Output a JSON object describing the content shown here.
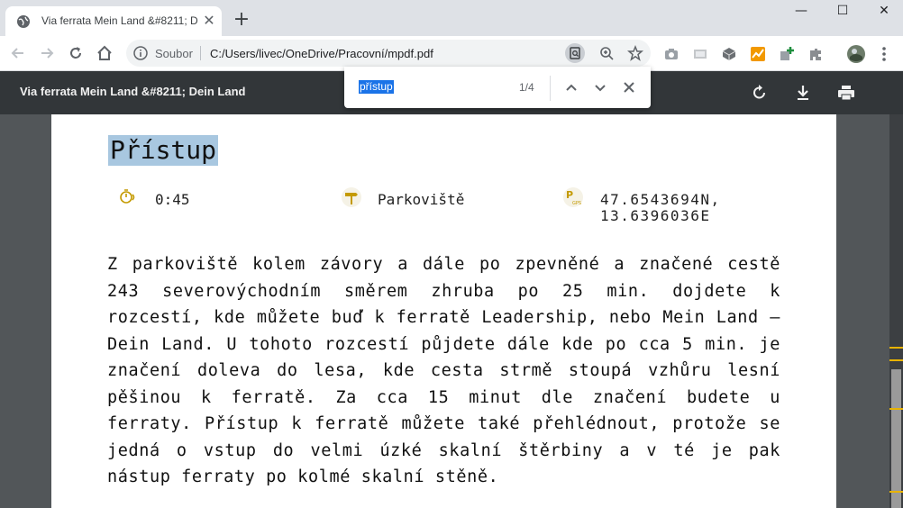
{
  "tab": {
    "title": "Via ferrata Mein Land &#8211; D",
    "close": "✕"
  },
  "newtab": "+",
  "window": {
    "minimize": "—",
    "maximize": "☐",
    "close": "✕"
  },
  "omnibox": {
    "scheme": "Soubor",
    "url": "C:/Users/livec/OneDrive/Pracovní/mpdf.pdf"
  },
  "pdf": {
    "title": "Via ferrata Mein Land &#8211; Dein Land"
  },
  "find": {
    "query": "přístup",
    "count": "1/4"
  },
  "content": {
    "heading": "Přístup",
    "time": "0:45",
    "parking": "Parkoviště",
    "gps_line1": "47.6543694N,",
    "gps_line2": "13.6396036E",
    "paragraph": "Z parkoviště kolem závory a dále po zpevněné a značené cestě 243 severovýchodním směrem zhruba po 25 min. dojdete k rozcestí, kde můžete buď k ferratě Leadership, nebo Mein Land – Dein Land. U tohoto rozcestí půjdete dále kde po cca 5 min. je značení doleva do lesa, kde cesta strmě stoupá vzhůru lesní pěšinou k ferratě. Za cca 15 minut dle značení budete u ferraty. Přístup k ferratě můžete také přehlédnout, protože se jedná o vstup do velmi úzké skalní štěrbiny a v té je pak nástup ferraty po kolmé skalní stěně."
  },
  "colors": {
    "find_highlight": "#a8c7e0",
    "find_match_marker": "#e8b300",
    "pdf_toolbar": "#323639"
  }
}
